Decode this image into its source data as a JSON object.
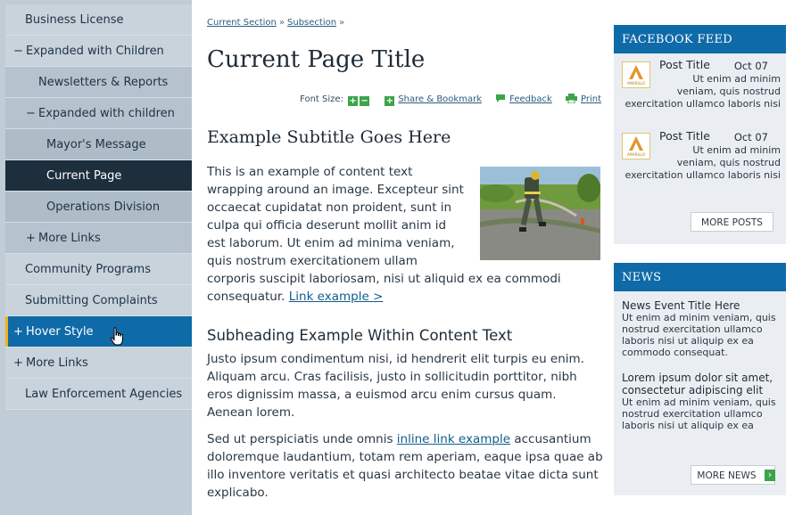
{
  "sidebar": {
    "items": [
      {
        "label": "Business License",
        "sign": ""
      },
      {
        "label": "Expanded with Children",
        "sign": "−"
      },
      {
        "label": "Newsletters & Reports",
        "sign": ""
      },
      {
        "label": "Expanded with children",
        "sign": "−"
      },
      {
        "label": "Mayor's Message",
        "sign": ""
      },
      {
        "label": "Current Page",
        "sign": ""
      },
      {
        "label": "Operations Division",
        "sign": ""
      },
      {
        "label": "More Links",
        "sign": "+"
      },
      {
        "label": "Community Programs",
        "sign": ""
      },
      {
        "label": "Submitting Complaints",
        "sign": ""
      },
      {
        "label": "Hover Style",
        "sign": "+"
      },
      {
        "label": "More Links",
        "sign": "+"
      },
      {
        "label": "Law Enforcement Agencies",
        "sign": ""
      }
    ]
  },
  "breadcrumb": {
    "section": "Current Section",
    "subsection": "Subsection",
    "sep": "»"
  },
  "page": {
    "title": "Current Page Title",
    "subtitle": "Example Subtitle Goes Here",
    "tools": {
      "font_size": "Font Size:",
      "plus": "+",
      "minus": "−",
      "share": "Share & Bookmark",
      "feedback": "Feedback",
      "print": "Print"
    },
    "para1": "This is an example of content text wrapping around an image. Excepteur sint occaecat cupidatat non proident, sunt in culpa qui officia deserunt mollit anim id est laborum.  Ut enim ad minima veniam, quis nostrum exercitationem ullam corporis suscipit laboriosam, nisi ut aliquid ex ea commodi consequatur.",
    "link_example": "Link example >",
    "subheading": "Subheading Example Within Content Text",
    "para2": "Justo ipsum condimentum nisi, id hendrerit elit turpis eu enim. Aliquam arcu. Cras facilisis, justo in sollicitudin porttitor, nibh eros dignissim massa, a euismod arcu enim cursus quam. Aenean lorem.",
    "para3_a": "Sed ut perspiciatis unde omnis",
    "inline_link": "inline link example",
    "para3_b": "accusantium doloremque laudantium, totam rem aperiam, eaque ipsa quae ab illo inventore veritatis et quasi architecto beatae vitae dicta sunt explicabo."
  },
  "facebook": {
    "heading": "FACEBOOK FEED",
    "posts": [
      {
        "title": "Post Title",
        "date": "Oct 07",
        "text": "Ut enim ad minim\nveniam, quis nostrud\nexercitation ullamco laboris nisi"
      },
      {
        "title": "Post Title",
        "date": "Oct 07",
        "text": "Ut enim ad minim\nveniam, quis nostrud\nexercitation ullamco laboris nisi"
      }
    ],
    "more": "MORE POSTS",
    "logo_text": "AMARILLO"
  },
  "news": {
    "heading": "NEWS",
    "items": [
      {
        "title": "News Event Title Here",
        "text": "Ut enim ad minim veniam, quis nostrud exercitation ullamco laboris nisi ut aliquip ex ea commodo consequat."
      },
      {
        "title": "Lorem ipsum dolor sit amet, consectetur adipiscing elit",
        "text": "Ut enim ad minim veniam, quis nostrud exercitation ullamco laboris nisi ut aliquip ex ea"
      }
    ],
    "more": "MORE NEWS",
    "more_arrow": "›"
  },
  "colors": {
    "accent": "#0f6aa8",
    "nav_current": "#1d2e3d",
    "hover_bar": "#f2b21b",
    "green_icon": "#3ca44a"
  }
}
